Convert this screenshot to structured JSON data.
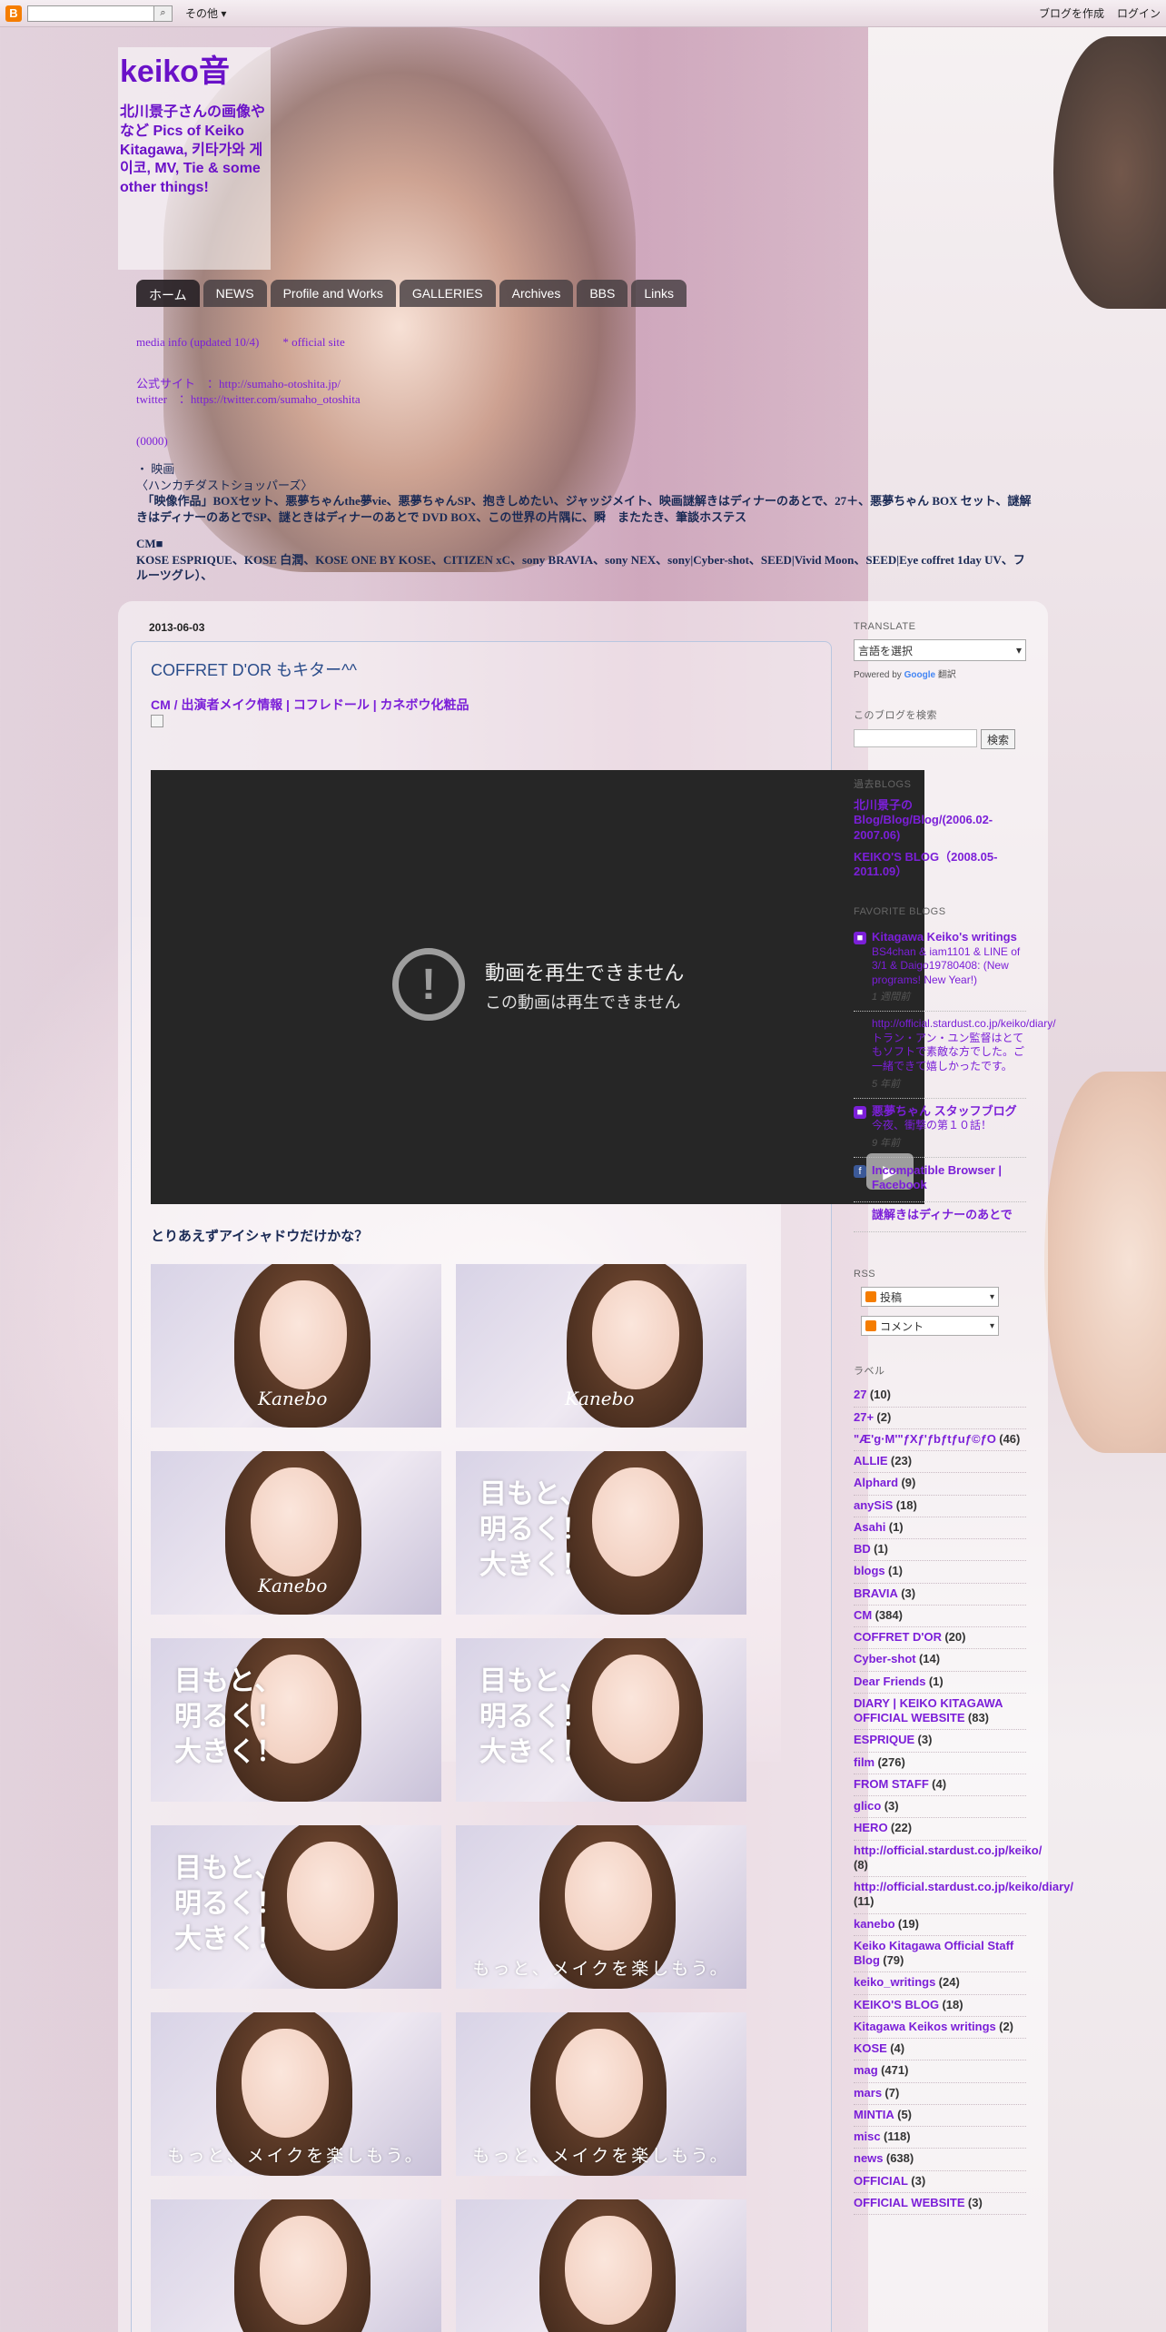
{
  "navbar": {
    "logo": "B",
    "search_placeholder": "",
    "search_icon": "magnifier-icon",
    "more": "その他 ▾",
    "create_blog": "ブログを作成",
    "login": "ログイン"
  },
  "header": {
    "title": "keiko音",
    "description": "北川景子さんの画像やなど Pics of Keiko Kitagawa, 키타가와 게이코, MV, Tie & some other things!"
  },
  "tabs": [
    "ホーム",
    "NEWS",
    "Profile and Works",
    "GALLERIES",
    "Archives",
    "BBS",
    "Links"
  ],
  "info": {
    "line1": "media info (updated 10/4)　　* official site",
    "line2": "公式サイト　：http://sumaho-otoshita.jp/",
    "line3": "twitter　：https://twitter.com/sumaho_otoshita",
    "line4": "(0000)",
    "line5": "・ 映画",
    "line6": "〈ハンカチダストショッパーズ〉",
    "line7": "　「映像作品」BOXセット、悪夢ちゃんthe夢vie、悪夢ちゃんSP、抱きしめたい、ジャッジメイト、映画謎解きはディナーのあとで、27＋、悪夢ちゃん BOX セット、謎解きはディナーのあとでSP、謎ときはディナーのあとで DVD BOX、この世界の片隅に、瞬　またたき、筆談ホステス",
    "line8": "CM■",
    "line9": "KOSE ESPRIQUE、KOSE 白潤、KOSE ONE BY KOSE、CITIZEN xC、sony BRAVIA、sony NEX、sony|Cyber-shot、SEED|Vivid Moon、SEED|Eye coffret 1day UV、フルーツグレ）、"
  },
  "post": {
    "date": "2013-06-03",
    "title": "COFFRET D'OR もキター^^",
    "labels": "CM / 出演者メイク情報 | コフレドール | カネボウ化粧品",
    "video_title": "動画を再生できません",
    "video_sub": "この動画は再生できません",
    "video_icon": "exclamation-icon",
    "caption": "とりあえずアイシャドウだけかな？",
    "photos": [
      {
        "text": "",
        "brand": "Kanebo",
        "slogan": ""
      },
      {
        "text": "",
        "brand": "Kanebo",
        "slogan": ""
      },
      {
        "text": "",
        "brand": "Kanebo",
        "slogan": ""
      },
      {
        "text": "目もと、\n明るく！\n大きく！",
        "brand": "",
        "slogan": ""
      },
      {
        "text": "目もと、\n明るく！\n大きく！",
        "brand": "",
        "slogan": ""
      },
      {
        "text": "目もと、\n明るく！\n大きく！",
        "brand": "",
        "slogan": ""
      },
      {
        "text": "目もと、\n明るく！\n大きく！",
        "brand": "",
        "slogan": ""
      },
      {
        "text": "",
        "brand": "",
        "slogan": "もっと、メイクを楽しもう。"
      },
      {
        "text": "",
        "brand": "",
        "slogan": "もっと、メイクを楽しもう。"
      },
      {
        "text": "",
        "brand": "",
        "slogan": "もっと、メイクを楽しもう。"
      },
      {
        "text": "",
        "brand": "",
        "slogan": ""
      },
      {
        "text": "",
        "brand": "",
        "slogan": ""
      }
    ]
  },
  "sidebar": {
    "translate_title": "TRANSLATE",
    "translate_select": "言語を選択",
    "powered_by": "Powered by",
    "google": "Google",
    "translate_word": "翻訳",
    "search_title": "このブログを検索",
    "search_btn": "検索",
    "past_title": "過去BLOGS",
    "past_links": [
      "北川景子のBlog/Blog/Blog/(2006.02-2007.06)",
      "KEIKO'S BLOG（2008.05-2011.09）"
    ],
    "fav_title": "FAVORITE BLOGS",
    "favorites": [
      {
        "title": "Kitagawa Keiko's writings",
        "snippet": "BS4chan & iam1101 & LINE of 3/1 & Daigo19780408: (New programs! New Year!)",
        "age": "1 週間前",
        "icon": "blog-icon",
        "icon_color": "#7b1fd8"
      },
      {
        "title": "",
        "snippet": "http://official.stardust.co.jp/keiko/diary/ トラン・アン・ユン監督はとてもソフトで素敵な方でした。ご一緒できて嬉しかったです。",
        "age": "5 年前",
        "icon": "",
        "icon_color": "#ffffff"
      },
      {
        "title": "悪夢ちゃん スタッフブログ",
        "snippet": "今夜、衝撃の第１０話！",
        "age": "9 年前",
        "icon": "blog-icon",
        "icon_color": "#7b1fd8"
      },
      {
        "title": "Incompatible Browser | Facebook",
        "snippet": "",
        "age": "",
        "icon": "facebook-icon",
        "icon_color": "#3b5998"
      },
      {
        "title": "謎解きはディナーのあとで",
        "snippet": "",
        "age": "",
        "icon": "",
        "icon_color": "#ffffff"
      }
    ],
    "rss_title": "RSS",
    "rss_posts": "投稿",
    "rss_comments": "コメント",
    "labels_title": "ラベル",
    "labels": [
      {
        "name": "27",
        "count": "(10)"
      },
      {
        "name": "27+",
        "count": "(2)"
      },
      {
        "name": "\"Æ'g·M'\"ƒXƒ'ƒbƒtƒuƒ©ƒO",
        "count": "(46)"
      },
      {
        "name": "ALLIE",
        "count": "(23)"
      },
      {
        "name": "Alphard",
        "count": "(9)"
      },
      {
        "name": "anySiS",
        "count": "(18)"
      },
      {
        "name": "Asahi",
        "count": "(1)"
      },
      {
        "name": "BD",
        "count": "(1)"
      },
      {
        "name": "blogs",
        "count": "(1)"
      },
      {
        "name": "BRAVIA",
        "count": "(3)"
      },
      {
        "name": "CM",
        "count": "(384)"
      },
      {
        "name": "COFFRET D'OR",
        "count": "(20)"
      },
      {
        "name": "Cyber-shot",
        "count": "(14)"
      },
      {
        "name": "Dear Friends",
        "count": "(1)"
      },
      {
        "name": "DIARY | KEIKO KITAGAWA OFFICIAL WEBSITE",
        "count": "(83)"
      },
      {
        "name": "ESPRIQUE",
        "count": "(3)"
      },
      {
        "name": "film",
        "count": "(276)"
      },
      {
        "name": "FROM STAFF",
        "count": "(4)"
      },
      {
        "name": "glico",
        "count": "(3)"
      },
      {
        "name": "HERO",
        "count": "(22)"
      },
      {
        "name": "http://official.stardust.co.jp/keiko/",
        "count": "(8)"
      },
      {
        "name": "http://official.stardust.co.jp/keiko/diary/",
        "count": "(11)"
      },
      {
        "name": "kanebo",
        "count": "(19)"
      },
      {
        "name": "Keiko Kitagawa Official Staff Blog",
        "count": "(79)"
      },
      {
        "name": "keiko_writings",
        "count": "(24)"
      },
      {
        "name": "KEIKO'S BLOG",
        "count": "(18)"
      },
      {
        "name": "Kitagawa Keikos writings",
        "count": "(2)"
      },
      {
        "name": "KOSE",
        "count": "(4)"
      },
      {
        "name": "mag",
        "count": "(471)"
      },
      {
        "name": "mars",
        "count": "(7)"
      },
      {
        "name": "MINTIA",
        "count": "(5)"
      },
      {
        "name": "misc",
        "count": "(118)"
      },
      {
        "name": "news",
        "count": "(638)"
      },
      {
        "name": "OFFICIAL",
        "count": "(3)"
      },
      {
        "name": "OFFICIAL WEBSITE",
        "count": "(3)"
      }
    ]
  }
}
